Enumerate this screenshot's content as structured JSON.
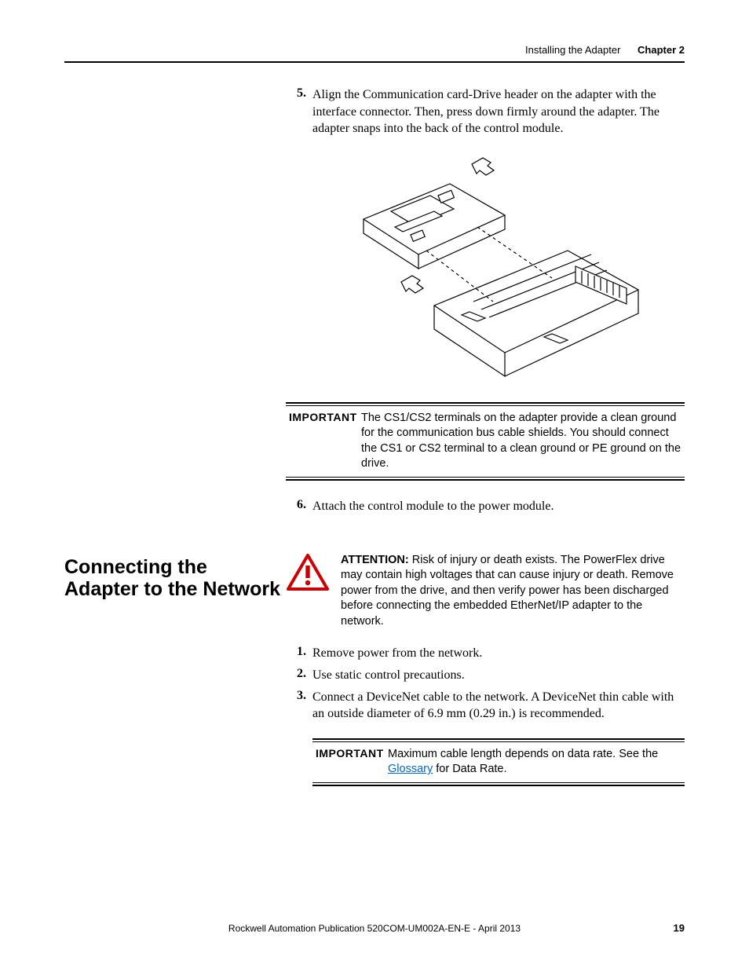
{
  "header": {
    "section": "Installing the Adapter",
    "chapter": "Chapter 2"
  },
  "step5": {
    "num": "5.",
    "text": "Align the Communication card-Drive header on the adapter with the interface connector. Then, press down firmly around the adapter. The adapter snaps into the back of the control module."
  },
  "important1": {
    "label": "IMPORTANT",
    "text": "The CS1/CS2 terminals on the adapter provide a clean ground for the communication bus cable shields. You should connect the CS1 or CS2 terminal to a clean ground or PE ground on the drive."
  },
  "step6": {
    "num": "6.",
    "text": "Attach the control module to the power module."
  },
  "section_heading": "Connecting the Adapter to the Network",
  "attention": {
    "label": "ATTENTION:",
    "text": " Risk of injury or death exists. The PowerFlex drive may contain high voltages that can cause injury or death. Remove power from the drive, and then verify power has been discharged before connecting the embedded EtherNet/IP adapter to the network."
  },
  "steps_b": {
    "s1": {
      "num": "1.",
      "text": "Remove power from the network."
    },
    "s2": {
      "num": "2.",
      "text": "Use static control precautions."
    },
    "s3": {
      "num": "3.",
      "text": "Connect a DeviceNet cable to the network. A DeviceNet thin cable with an outside diameter of 6.9 mm (0.29 in.) is recommended."
    }
  },
  "important2": {
    "label": "IMPORTANT",
    "pre": "Maximum cable length depends on data rate. See the ",
    "link": "Glossary",
    "post": " for Data Rate."
  },
  "footer": "Rockwell Automation Publication 520COM-UM002A-EN-E - April 2013",
  "page_number": "19"
}
